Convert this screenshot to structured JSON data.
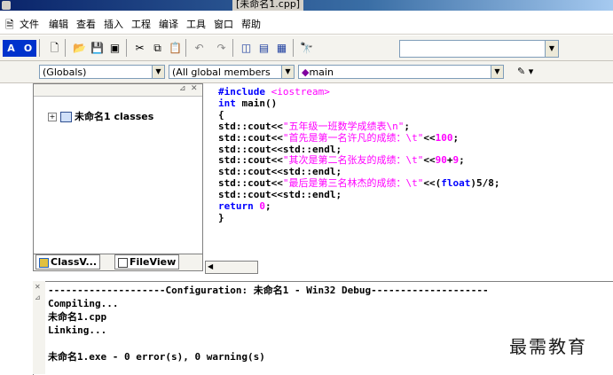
{
  "window": {
    "title": "[未命名1.cpp]"
  },
  "menu": {
    "items": [
      "文件",
      "编辑",
      "查看",
      "插入",
      "工程",
      "编译",
      "工具",
      "窗口",
      "帮助"
    ]
  },
  "toolbar": {
    "find_value": ""
  },
  "context": {
    "scope": "(Globals)",
    "members": "(All global members",
    "function": "main"
  },
  "workspace": {
    "tree_label": "未命名1 classes",
    "tabs": [
      "ClassV...",
      "FileView"
    ]
  },
  "editor": {
    "lines": [
      [
        {
          "t": "#include ",
          "c": "kw"
        },
        {
          "t": "<iostream>",
          "c": "str"
        }
      ],
      [
        {
          "t": "int",
          "c": "kw"
        },
        {
          "t": " main()",
          "c": ""
        }
      ],
      [
        {
          "t": "{",
          "c": ""
        }
      ],
      [
        {
          "t": "std::cout<<",
          "c": ""
        },
        {
          "t": "\"五年级一班数学成绩表\\n\"",
          "c": "str"
        },
        {
          "t": ";",
          "c": ""
        }
      ],
      [
        {
          "t": "std::cout<<",
          "c": ""
        },
        {
          "t": "\"首先是第一名许凡的成绩：\\t\"",
          "c": "str"
        },
        {
          "t": "<<",
          "c": ""
        },
        {
          "t": "100",
          "c": "num"
        },
        {
          "t": ";",
          "c": ""
        }
      ],
      [
        {
          "t": "std::cout<<std::endl;",
          "c": ""
        }
      ],
      [
        {
          "t": "std::cout<<",
          "c": ""
        },
        {
          "t": "\"其次是第二名张友的成绩：\\t\"",
          "c": "str"
        },
        {
          "t": "<<",
          "c": ""
        },
        {
          "t": "90",
          "c": "num"
        },
        {
          "t": "+",
          "c": ""
        },
        {
          "t": "9",
          "c": "num"
        },
        {
          "t": ";",
          "c": ""
        }
      ],
      [
        {
          "t": "std::cout<<std::endl;",
          "c": ""
        }
      ],
      [
        {
          "t": "std::cout<<",
          "c": ""
        },
        {
          "t": "\"最后是第三名林杰的成绩：\\t\"",
          "c": "str"
        },
        {
          "t": "<<(",
          "c": ""
        },
        {
          "t": "float",
          "c": "kw"
        },
        {
          "t": ")5/8;",
          "c": ""
        }
      ],
      [
        {
          "t": "std::cout<<std::endl;",
          "c": ""
        }
      ],
      [
        {
          "t": "return",
          "c": "kw"
        },
        {
          "t": " ",
          "c": ""
        },
        {
          "t": "0",
          "c": "num"
        },
        {
          "t": ";",
          "c": ""
        }
      ],
      [
        {
          "t": "}",
          "c": ""
        }
      ]
    ]
  },
  "output": {
    "lines": [
      "--------------------Configuration: 未命名1 - Win32 Debug--------------------",
      "Compiling...",
      "未命名1.cpp",
      "Linking...",
      "",
      "未命名1.exe - 0 error(s), 0 warning(s)"
    ]
  },
  "watermark": "最需教育",
  "colors": {
    "keyword": "#0000ff",
    "string": "#ff00ff",
    "number": "#ff00ff"
  }
}
